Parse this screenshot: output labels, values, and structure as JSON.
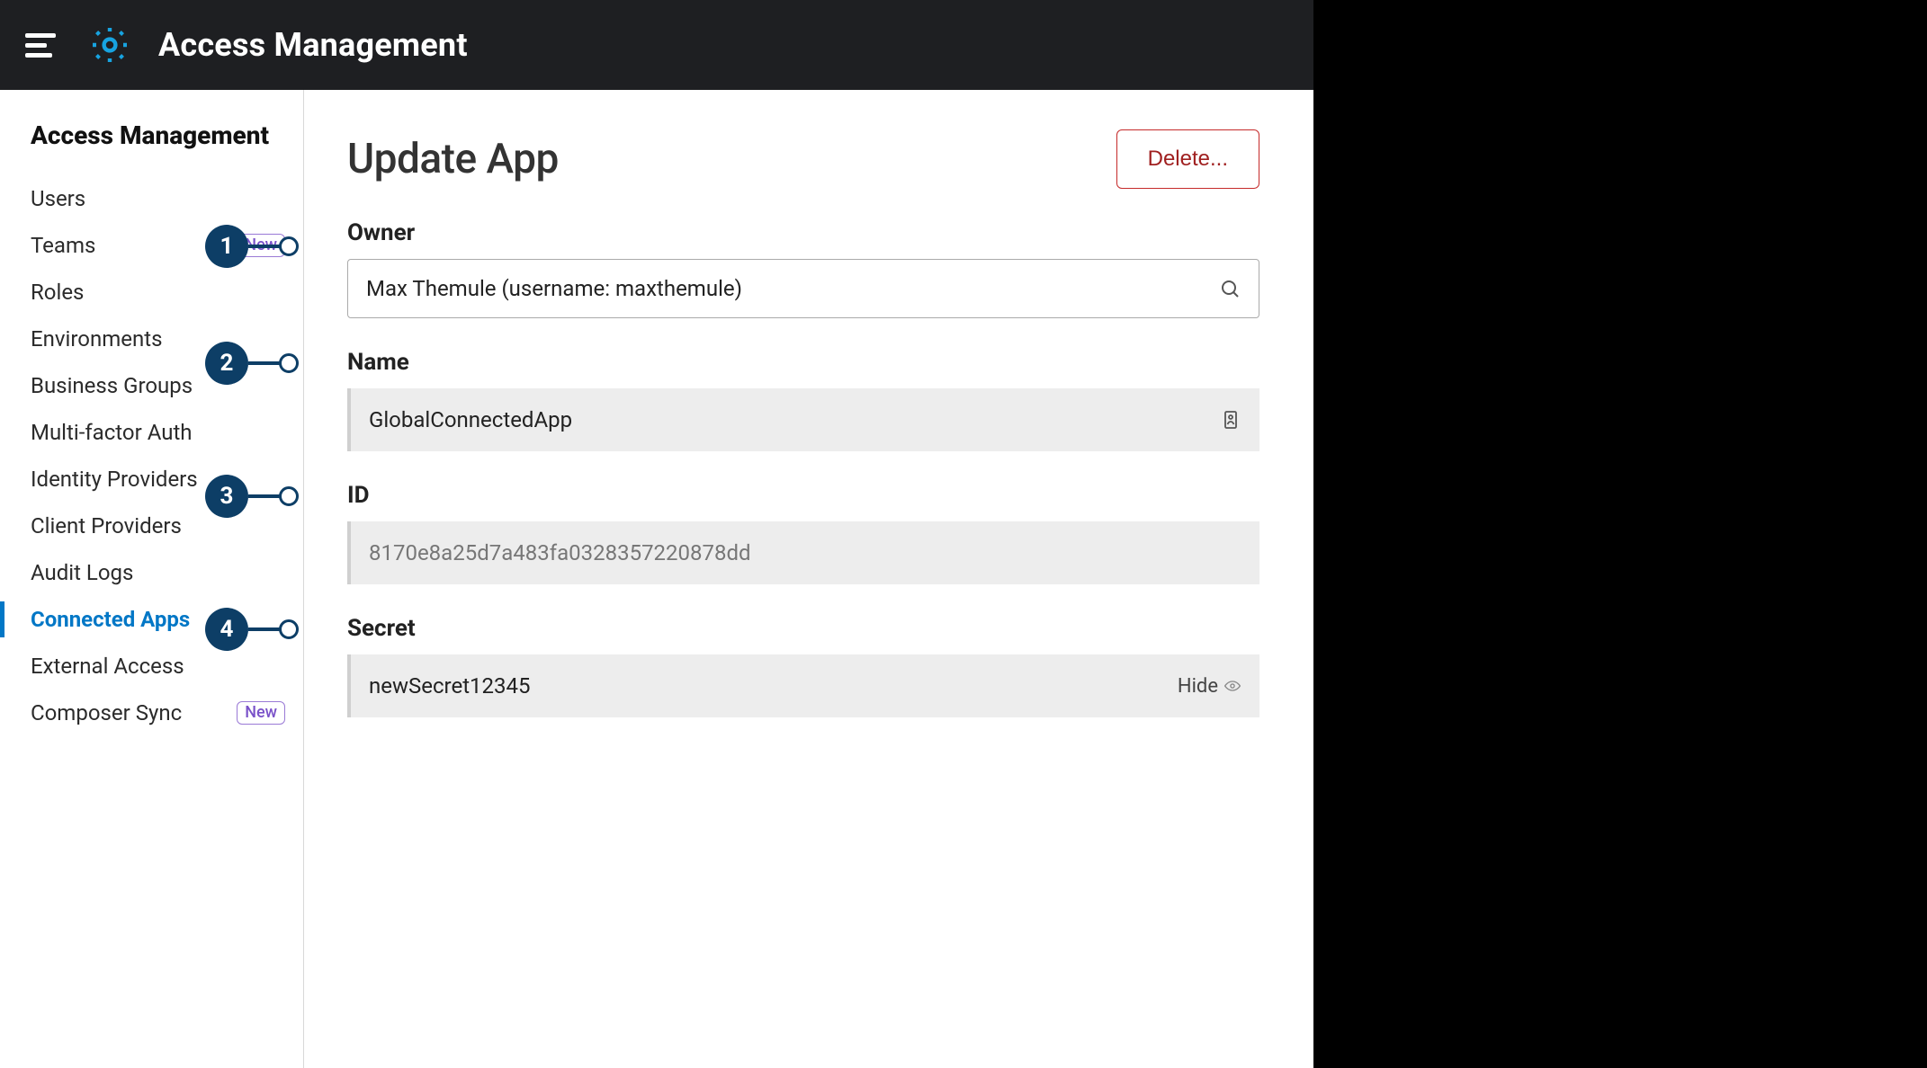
{
  "header": {
    "title": "Access Management"
  },
  "sidebar": {
    "heading": "Access Management",
    "new_badge": "New",
    "items": [
      {
        "label": "Users",
        "active": false,
        "has_new": false
      },
      {
        "label": "Teams",
        "active": false,
        "has_new": true
      },
      {
        "label": "Roles",
        "active": false,
        "has_new": false
      },
      {
        "label": "Environments",
        "active": false,
        "has_new": false
      },
      {
        "label": "Business Groups",
        "active": false,
        "has_new": false
      },
      {
        "label": "Multi-factor Auth",
        "active": false,
        "has_new": false
      },
      {
        "label": "Identity Providers",
        "active": false,
        "has_new": false
      },
      {
        "label": "Client Providers",
        "active": false,
        "has_new": false
      },
      {
        "label": "Audit Logs",
        "active": false,
        "has_new": false
      },
      {
        "label": "Connected Apps",
        "active": true,
        "has_new": false
      },
      {
        "label": "External Access",
        "active": false,
        "has_new": false
      },
      {
        "label": "Composer Sync",
        "active": false,
        "has_new": true
      }
    ]
  },
  "main": {
    "title": "Update App",
    "delete_label": "Delete...",
    "fields": {
      "owner": {
        "label": "Owner",
        "value": "Max Themule (username: maxthemule)"
      },
      "name": {
        "label": "Name",
        "value": "GlobalConnectedApp"
      },
      "id": {
        "label": "ID",
        "value": "8170e8a25d7a483fa0328357220878dd"
      },
      "secret": {
        "label": "Secret",
        "value": "newSecret12345",
        "hide_label": "Hide"
      }
    }
  },
  "callouts": [
    "1",
    "2",
    "3",
    "4"
  ]
}
